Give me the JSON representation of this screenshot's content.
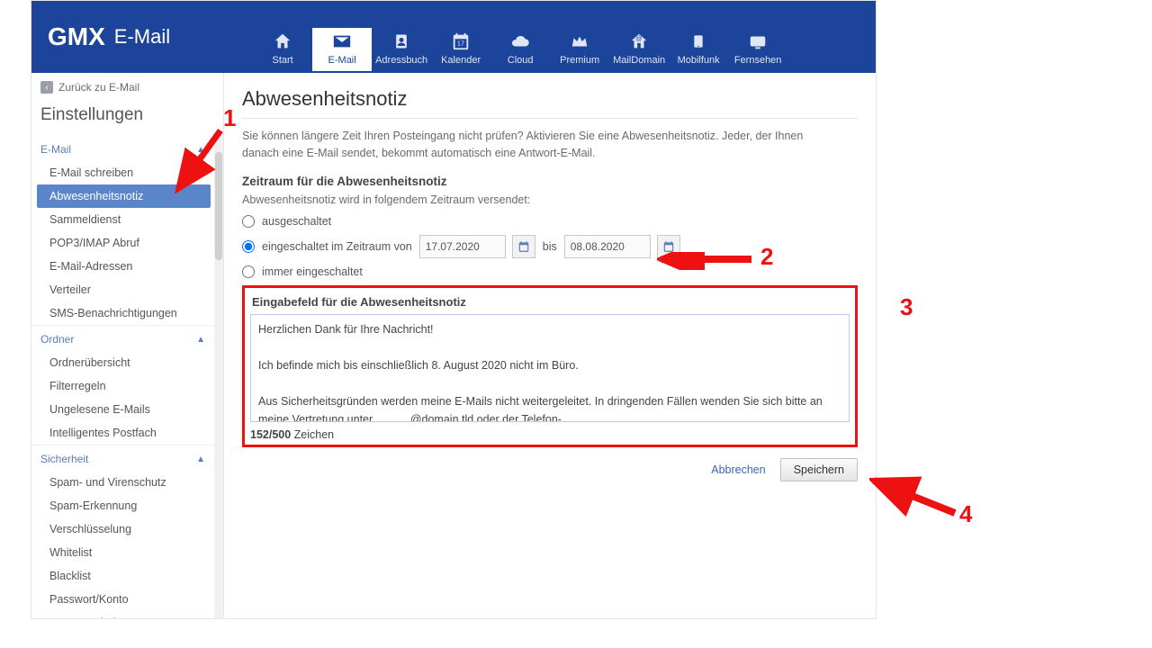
{
  "brand": {
    "name": "GMX",
    "product": "E-Mail"
  },
  "nav": [
    {
      "key": "start",
      "label": "Start"
    },
    {
      "key": "email",
      "label": "E-Mail",
      "active": true
    },
    {
      "key": "adressbuch",
      "label": "Adressbuch"
    },
    {
      "key": "kalender",
      "label": "Kalender",
      "badge": "17"
    },
    {
      "key": "cloud",
      "label": "Cloud"
    },
    {
      "key": "premium",
      "label": "Premium"
    },
    {
      "key": "maildomain",
      "label": "MailDomain"
    },
    {
      "key": "mobilfunk",
      "label": "Mobilfunk"
    },
    {
      "key": "fernsehen",
      "label": "Fernsehen"
    }
  ],
  "sidebar": {
    "back": "Zurück zu E-Mail",
    "heading": "Einstellungen",
    "sections": [
      {
        "title": "E-Mail",
        "items": [
          "E-Mail schreiben",
          "Abwesenheitsnotiz",
          "Sammeldienst",
          "POP3/IMAP Abruf",
          "E-Mail-Adressen",
          "Verteiler",
          "SMS-Benachrichtigungen"
        ],
        "selected_index": 1
      },
      {
        "title": "Ordner",
        "items": [
          "Ordnerübersicht",
          "Filterregeln",
          "Ungelesene E-Mails",
          "Intelligentes Postfach"
        ]
      },
      {
        "title": "Sicherheit",
        "items": [
          "Spam- und Virenschutz",
          "Spam-Erkennung",
          "Verschlüsselung",
          "Whitelist",
          "Blacklist",
          "Passwort/Konto",
          "Externe Inhalte"
        ]
      }
    ]
  },
  "page": {
    "title": "Abwesenheitsnotiz",
    "intro": "Sie können längere Zeit Ihren Posteingang nicht prüfen? Aktivieren Sie eine Abwesenheitsnotiz. Jeder, der Ihnen danach eine E-Mail sendet, bekommt automatisch eine Antwort-E-Mail.",
    "period_heading": "Zeitraum für die Abwesenheitsnotiz",
    "period_desc": "Abwesenheitsnotiz wird in folgendem Zeitraum versendet:",
    "options": {
      "off": "ausgeschaltet",
      "range_prefix": "eingeschaltet im Zeitraum von",
      "range_middle": "bis",
      "always": "immer eingeschaltet",
      "selected": "range",
      "from": "17.07.2020",
      "to": "08.08.2020"
    },
    "message": {
      "heading": "Eingabefeld für die Abwesenheitsnotiz",
      "text": "Herzlichen Dank für Ihre Nachricht!\n\nIch befinde mich bis einschließlich 8. August 2020 nicht im Büro.\n\nAus Sicherheitsgründen werden meine E-Mails nicht weitergeleitet. In dringenden Fällen wenden Sie sich bitte an meine Vertretung unter            @domain.tld oder der Telefon-\n\nMit freundlichen Grüßen",
      "count": "152/500",
      "count_suffix": " Zeichen"
    },
    "actions": {
      "cancel": "Abbrechen",
      "save": "Speichern"
    }
  },
  "annotations": {
    "a1": "1",
    "a2": "2",
    "a3": "3",
    "a4": "4"
  }
}
